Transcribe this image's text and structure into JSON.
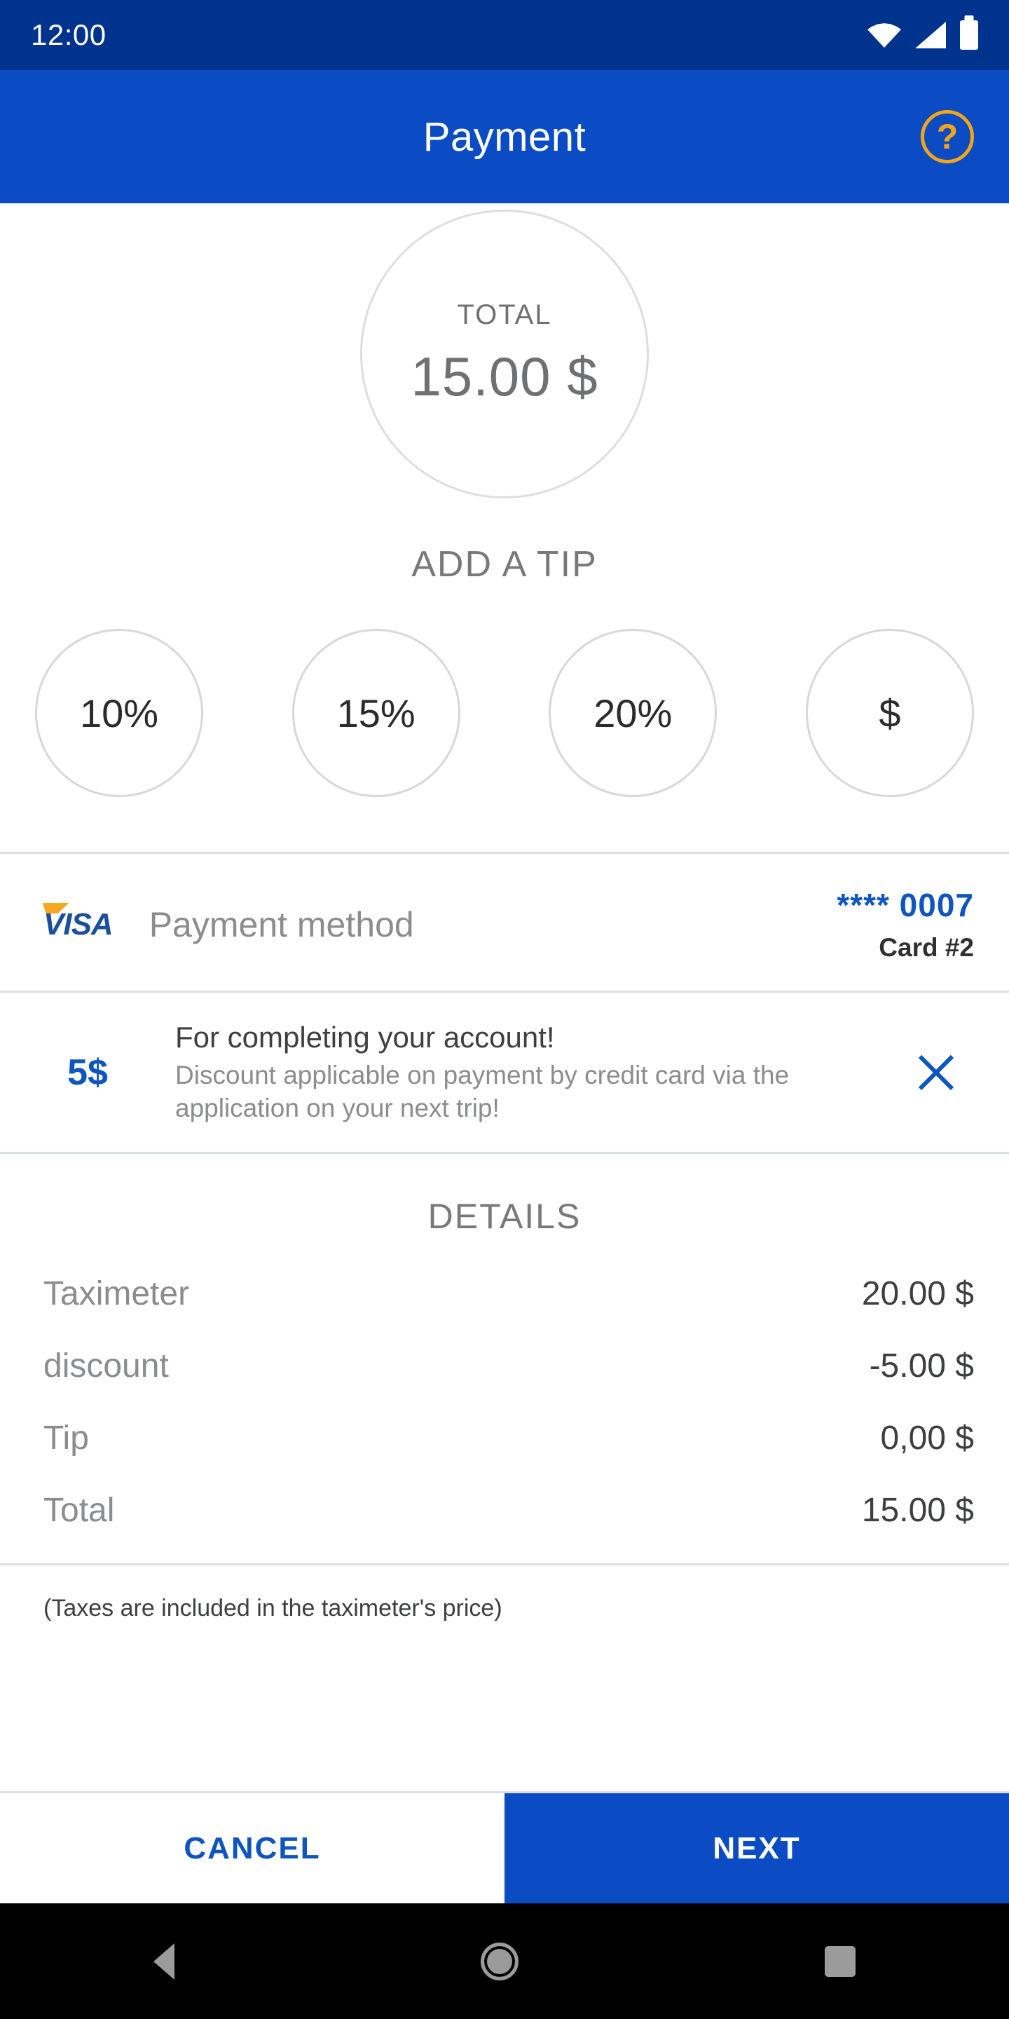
{
  "status_bar": {
    "time": "12:00",
    "icons": [
      "wifi-icon",
      "cellular-signal-icon",
      "battery-icon"
    ]
  },
  "app_bar": {
    "title": "Payment",
    "help_icon_glyph": "?",
    "background_color": "#0B4CC4",
    "help_color": "#F5A515"
  },
  "total": {
    "label": "TOTAL",
    "amount": "15.00 $"
  },
  "tip": {
    "heading": "ADD A TIP",
    "options": [
      {
        "label": "10%"
      },
      {
        "label": "15%"
      },
      {
        "label": "20%"
      },
      {
        "label": "$"
      }
    ]
  },
  "payment_method": {
    "brand": "VISA",
    "label": "Payment method",
    "card_number": "**** 0007",
    "card_name": "Card #2",
    "accent_color": "#0D55C0"
  },
  "promo": {
    "amount": "5$",
    "title": "For completing your account!",
    "description": "Discount applicable on payment by credit card via the application on your next trip!",
    "close_icon": "close-icon"
  },
  "details": {
    "heading": "DETAILS",
    "rows": [
      {
        "name": "Taximeter",
        "value": "20.00 $"
      },
      {
        "name": "discount",
        "value": "-5.00 $"
      },
      {
        "name": "Tip",
        "value": "0,00 $"
      },
      {
        "name": "Total",
        "value": "15.00 $"
      }
    ],
    "note": "(Taxes are included in the taximeter's price)"
  },
  "actions": {
    "cancel_label": "CANCEL",
    "next_label": "NEXT"
  },
  "nav_bar": {
    "back": "back-triangle-icon",
    "home": "home-circle-icon",
    "recents": "recents-square-icon"
  }
}
